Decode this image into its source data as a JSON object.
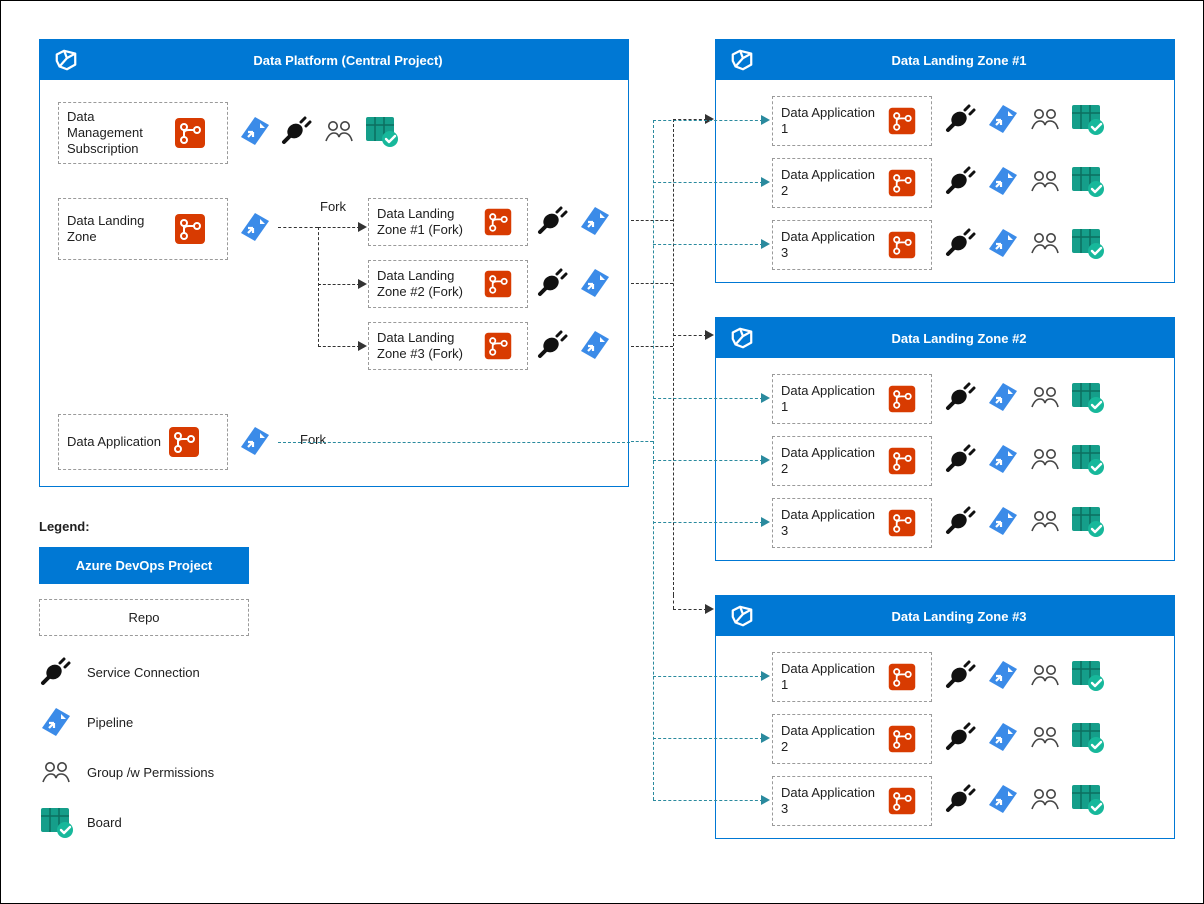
{
  "central": {
    "title": "Data Platform (Central Project)",
    "repo_mgmt": "Data Management Subscription",
    "repo_dlz": "Data Landing Zone",
    "repo_dapp": "Data Application",
    "fork1_label": "Fork",
    "fork2_label": "Fork",
    "fork_repos": [
      "Data Landing Zone #1 (Fork)",
      "Data Landing Zone #2 (Fork)",
      "Data Landing Zone #3 (Fork)"
    ]
  },
  "zones": [
    {
      "title": "Data Landing Zone #1",
      "apps": [
        "Data Application 1",
        "Data Application 2",
        "Data Application 3"
      ]
    },
    {
      "title": "Data Landing Zone #2",
      "apps": [
        "Data Application 1",
        "Data Application 2",
        "Data Application 3"
      ]
    },
    {
      "title": "Data Landing Zone #3",
      "apps": [
        "Data Application 1",
        "Data Application 2",
        "Data Application 3"
      ]
    }
  ],
  "legend": {
    "heading": "Legend:",
    "project": "Azure DevOps Project",
    "repo": "Repo",
    "service_connection": "Service Connection",
    "pipeline": "Pipeline",
    "group": "Group /w Permissions",
    "board": "Board"
  },
  "colors": {
    "azure_blue": "#0078d4",
    "repo_orange": "#d83b01",
    "pipeline_blue": "#3b8be8",
    "board_teal": "#159e8a",
    "plug_black": "#111111"
  }
}
